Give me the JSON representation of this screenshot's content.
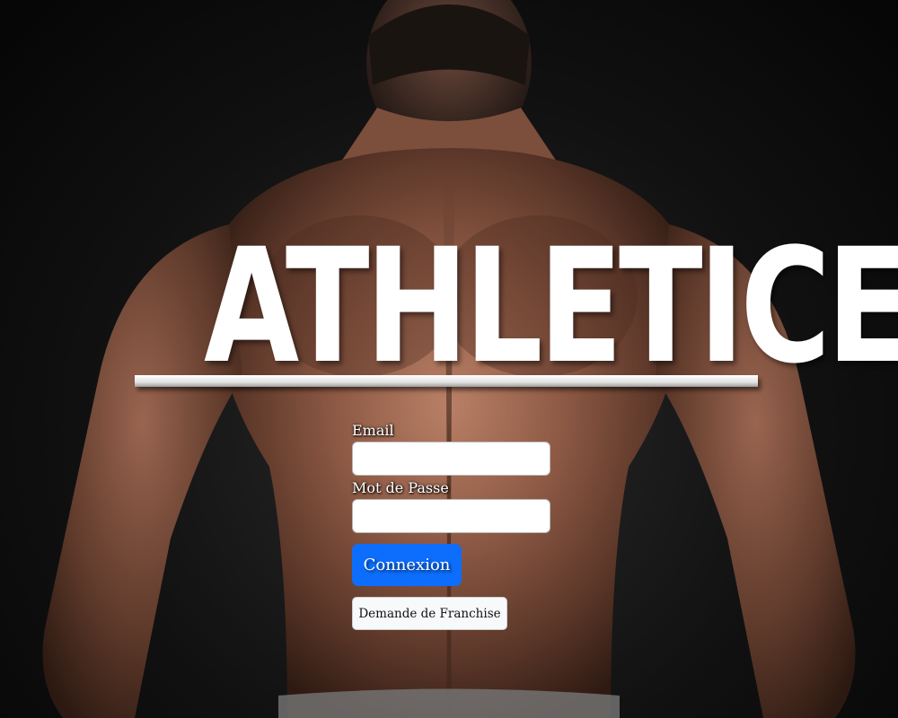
{
  "brand": {
    "title": "ATHLETICE"
  },
  "login": {
    "email_label": "Email",
    "email_value": "",
    "password_label": "Mot de Passe",
    "password_value": "",
    "submit_label": "Connexion",
    "franchise_label": "Demande de Franchise"
  },
  "colors": {
    "primary_button": "#0d6efd",
    "title": "#ffffff",
    "secondary_button": "#f8f9fa"
  }
}
